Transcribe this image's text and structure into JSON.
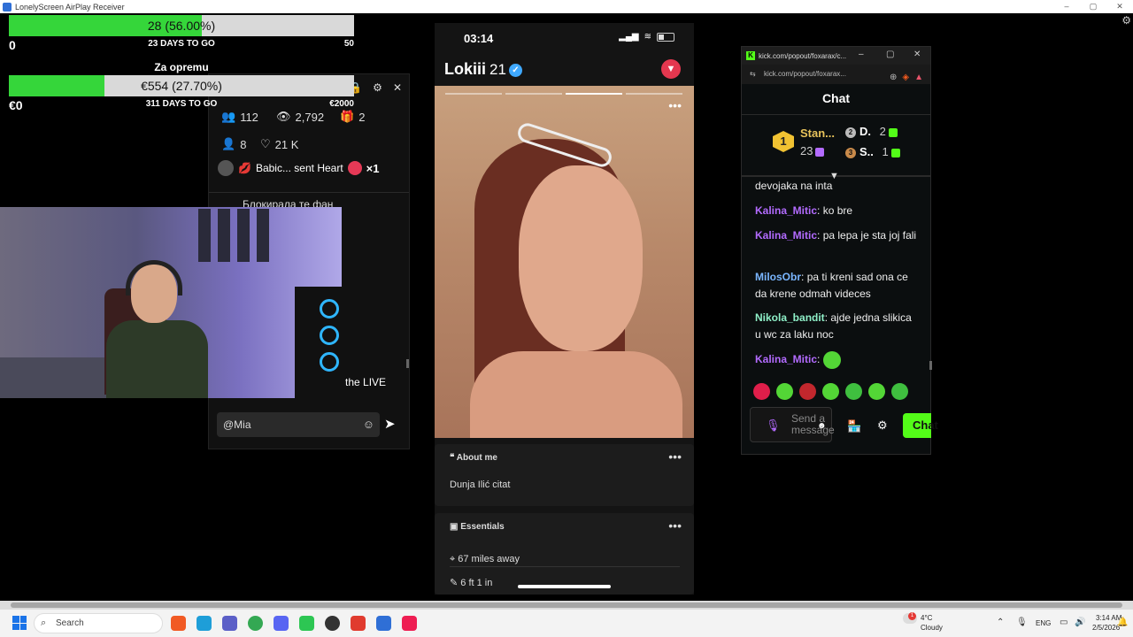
{
  "host": {
    "title": "LonelyScreen AirPlay Receiver"
  },
  "goals": [
    {
      "bar_text": "28 (56.00%)",
      "fraction": 0.56,
      "min": "0",
      "days": "23 DAYS TO GO",
      "max": "50"
    },
    {
      "bar_text": "€554 (27.70%)",
      "fraction": 0.277,
      "min": "€0",
      "days": "311 DAYS TO GO",
      "max": "€2000"
    }
  ],
  "goal2_label": "Za opremu",
  "tiktok": {
    "viewers": "112",
    "views": "2,792",
    "gifts": "2",
    "new_followers": "8",
    "likes": "21 K",
    "gift_text": "Babic... sent Heart",
    "gift_count": "×1",
    "cyrillic_message": "Блокирала те фан",
    "live_text": "the LIVE",
    "input_value": "@Mia"
  },
  "phone": {
    "time": "03:14",
    "name": "Lokiii",
    "age": "21",
    "about_title": "About me",
    "about_text": "Dunja Ilić citat",
    "essentials_title": "Essentials",
    "distance": "67 miles away",
    "height": "6 ft 1 in",
    "photo_index": 3,
    "photo_count": 4
  },
  "kick": {
    "tab_title": "kick.com/popout/foxarax/c...",
    "url": "kick.com/popout/foxarax...",
    "header": "Chat",
    "leaderboard": [
      {
        "rank": "1",
        "name": "Stan...",
        "count": "23"
      },
      {
        "rank": "2",
        "name": "D.",
        "count": "2"
      },
      {
        "rank": "3",
        "name": "S..",
        "count": "1"
      }
    ],
    "messages": [
      {
        "user": "",
        "text": "devojaka na inta",
        "color": "#eeeeee"
      },
      {
        "user": "Kalina_Mitic",
        "text": "ko bre",
        "color": "#b36bff"
      },
      {
        "user": "Kalina_Mitic",
        "text": "pa lepa je sta joj fali",
        "color": "#b36bff"
      },
      {
        "user": "MilosObr",
        "text": "pa ti kreni sad ona ce da krene odmah videces",
        "color": "#7ab6ff"
      },
      {
        "user": "Nikola_bandit",
        "text": "ajde jedna slikica u wc za laku noc",
        "color": "#8ff0c8"
      },
      {
        "user": "Kalina_Mitic",
        "text": "",
        "color": "#b36bff"
      }
    ],
    "placeholder": "Send a message",
    "chat_button": "Chat"
  },
  "taskbar": {
    "search_placeholder": "Search",
    "weather_temp": "4°C",
    "weather_desc": "Cloudy",
    "weather_badge": "1",
    "lang": "ENG",
    "time": "3:14 AM",
    "date": "2/5/2026"
  },
  "colors": {
    "goal_fill": "#35d63a",
    "kick_green": "#53fc18",
    "kick_purple": "#b36bff",
    "feeld_pin": "#e4374f"
  }
}
